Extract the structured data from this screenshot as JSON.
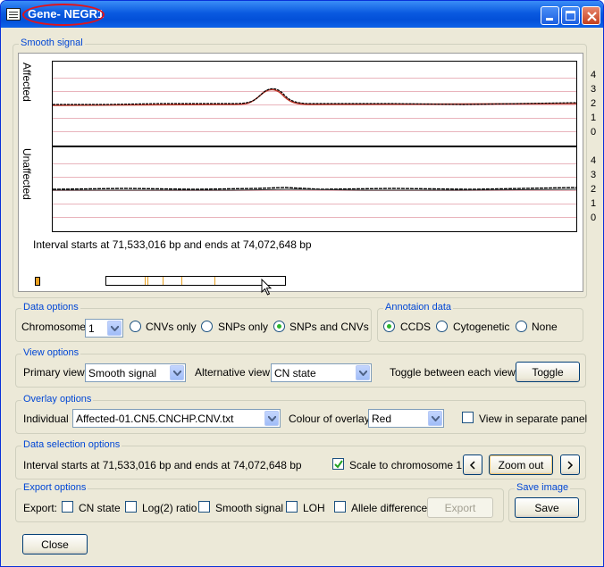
{
  "window": {
    "title": "Gene- NEGR1",
    "controls": [
      "minimize-icon",
      "maximize-icon",
      "close-icon"
    ]
  },
  "smooth_signal": {
    "legend": "Smooth signal",
    "panels": [
      {
        "label": "Affected",
        "ticks": [
          "4",
          "3",
          "2",
          "1",
          "0"
        ]
      },
      {
        "label": "Unaffected",
        "ticks": [
          "4",
          "3",
          "2",
          "1",
          "0"
        ]
      }
    ],
    "interval_text": "Interval starts at 71,533,016 bp and ends at 74,072,648 bp"
  },
  "data_options": {
    "legend": "Data options",
    "chromosome_label": "Chromosome",
    "chromosome_value": "1",
    "radios": [
      {
        "label": "CNVs only",
        "selected": false
      },
      {
        "label": "SNPs only",
        "selected": false
      },
      {
        "label": "SNPs and CNVs",
        "selected": true
      }
    ]
  },
  "annotation": {
    "legend": "Annotaion data",
    "radios": [
      {
        "label": "CCDS",
        "selected": true
      },
      {
        "label": "Cytogenetic",
        "selected": false
      },
      {
        "label": "None",
        "selected": false
      }
    ]
  },
  "view_options": {
    "legend": "View options",
    "primary_label": "Primary view",
    "primary_value": "Smooth signal",
    "alt_label": "Alternative view",
    "alt_value": "CN state",
    "toggle_text": "Toggle between each view",
    "toggle_button": "Toggle"
  },
  "overlay": {
    "legend": "Overlay options",
    "individual_label": "Individual",
    "individual_value": "Affected-01.CN5.CNCHP.CNV.txt",
    "colour_label": "Colour of overlay",
    "colour_value": "Red",
    "separate_label": "View in separate panel",
    "separate_checked": false
  },
  "selection": {
    "legend": "Data selection options",
    "interval_text": "Interval starts at 71,533,016 bp and ends at 74,072,648 bp",
    "scale_label": "Scale to chromosome 1",
    "scale_checked": true,
    "zoom_out": "Zoom out",
    "prev_icon": "chevron-left-icon",
    "next_icon": "chevron-right-icon"
  },
  "export": {
    "legend": "Export options",
    "label": "Export:",
    "options": [
      {
        "label": "CN state",
        "checked": false
      },
      {
        "label": "Log(2) ratio",
        "checked": false
      },
      {
        "label": "Smooth signal",
        "checked": false
      },
      {
        "label": "LOH",
        "checked": false
      },
      {
        "label": "Allele difference",
        "checked": false
      }
    ],
    "export_button": "Export"
  },
  "save_image": {
    "legend": "Save image",
    "button": "Save"
  },
  "close_button": "Close",
  "colors": {
    "title_bar": "#0a5ae0",
    "highlight_oval": "#e0141c",
    "group_legend": "#0046d5",
    "grid_line": "#e9b4bc",
    "signal_trace": "#000000",
    "overlay_trace": "#c0392b",
    "marker": "#e8a020"
  }
}
